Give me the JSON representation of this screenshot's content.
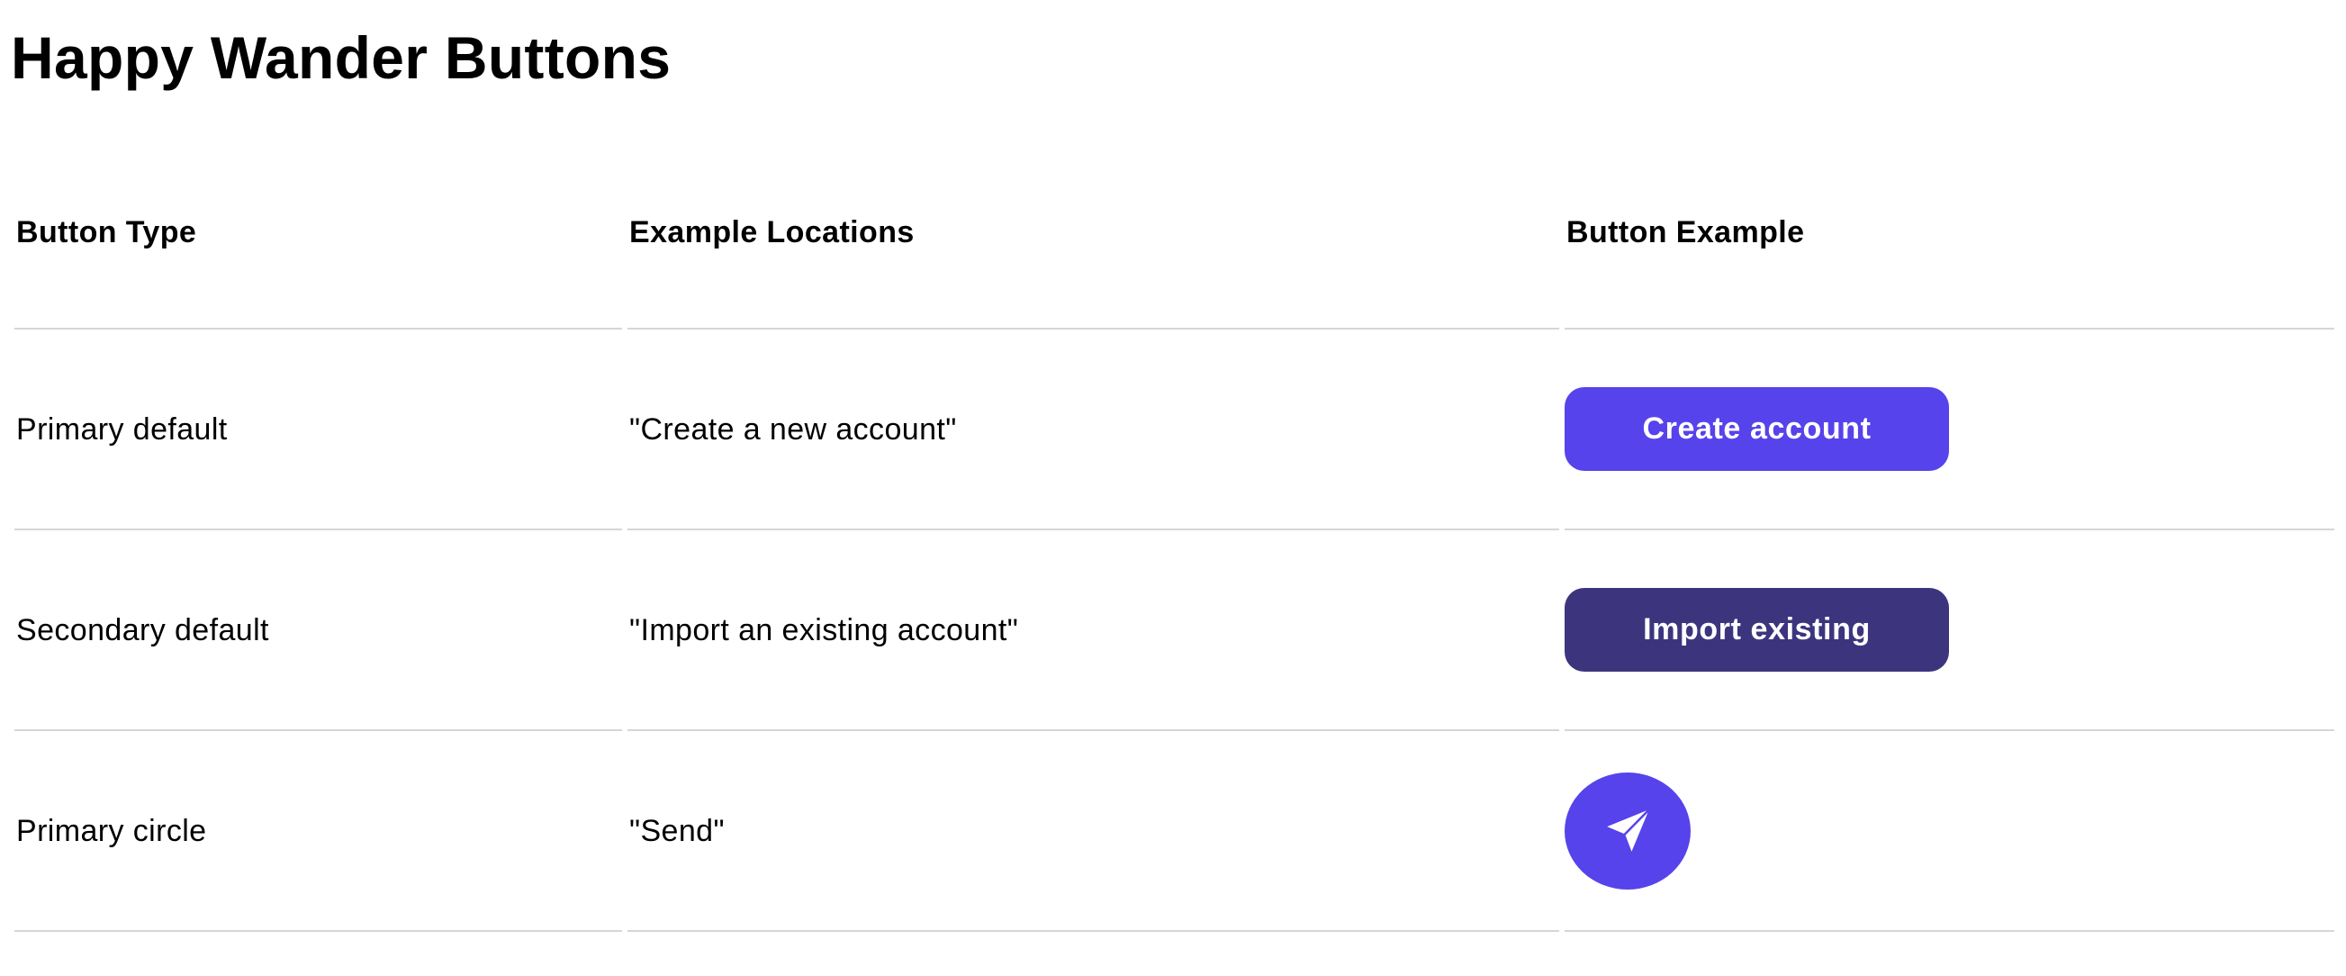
{
  "page": {
    "title": "Happy Wander Buttons"
  },
  "table": {
    "headers": [
      "Button Type",
      "Example Locations",
      "Button Example"
    ],
    "rows": [
      {
        "type": "Primary default",
        "location": "\"Create a new account\"",
        "button_label": "Create account"
      },
      {
        "type": "Secondary default",
        "location": "\"Import an existing account\"",
        "button_label": "Import existing"
      },
      {
        "type": "Primary circle",
        "location": "\"Send\"",
        "button_icon": "send-icon"
      }
    ]
  },
  "colors": {
    "primary": "#5643eb",
    "secondary": "#3c357e",
    "divider": "#d6d6d6",
    "text": "#000000"
  }
}
